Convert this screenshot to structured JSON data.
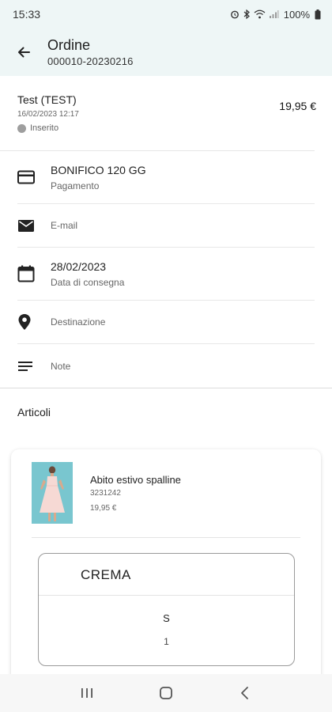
{
  "status_bar": {
    "time": "15:33",
    "battery": "100%",
    "icons": [
      "alarm-icon",
      "bluetooth-icon",
      "wifi-icon",
      "signal-icon",
      "battery-icon"
    ]
  },
  "app_bar": {
    "title": "Ordine",
    "subtitle": "000010-20230216",
    "back_icon": "arrow-left-icon"
  },
  "order": {
    "customer": "Test (TEST)",
    "datetime": "16/02/2023 12:17",
    "status": "Inserito",
    "total": "19,95 €"
  },
  "details": {
    "payment": {
      "value": "BONIFICO 120 GG",
      "label": "Pagamento",
      "icon": "credit-card-icon"
    },
    "email": {
      "placeholder": "E-mail",
      "icon": "mail-icon"
    },
    "delivery": {
      "value": "28/02/2023",
      "label": "Data di consegna",
      "icon": "calendar-icon"
    },
    "destination": {
      "placeholder": "Destinazione",
      "icon": "location-pin-icon"
    },
    "notes": {
      "placeholder": "Note",
      "icon": "notes-icon"
    }
  },
  "articles": {
    "section_title": "Articoli",
    "items": [
      {
        "name": "Abito estivo spalline",
        "code": "3231242",
        "price": "19,95 €",
        "variant": {
          "color": "CREMA",
          "size": "S",
          "quantity": "1"
        }
      }
    ]
  },
  "nav_bar": {
    "buttons": [
      "recents-icon",
      "home-icon",
      "back-icon"
    ]
  },
  "colors": {
    "header_bg": "#eef6f6",
    "status_dot": "#9e9e9e",
    "thumb_bg": "#79c6cf"
  }
}
